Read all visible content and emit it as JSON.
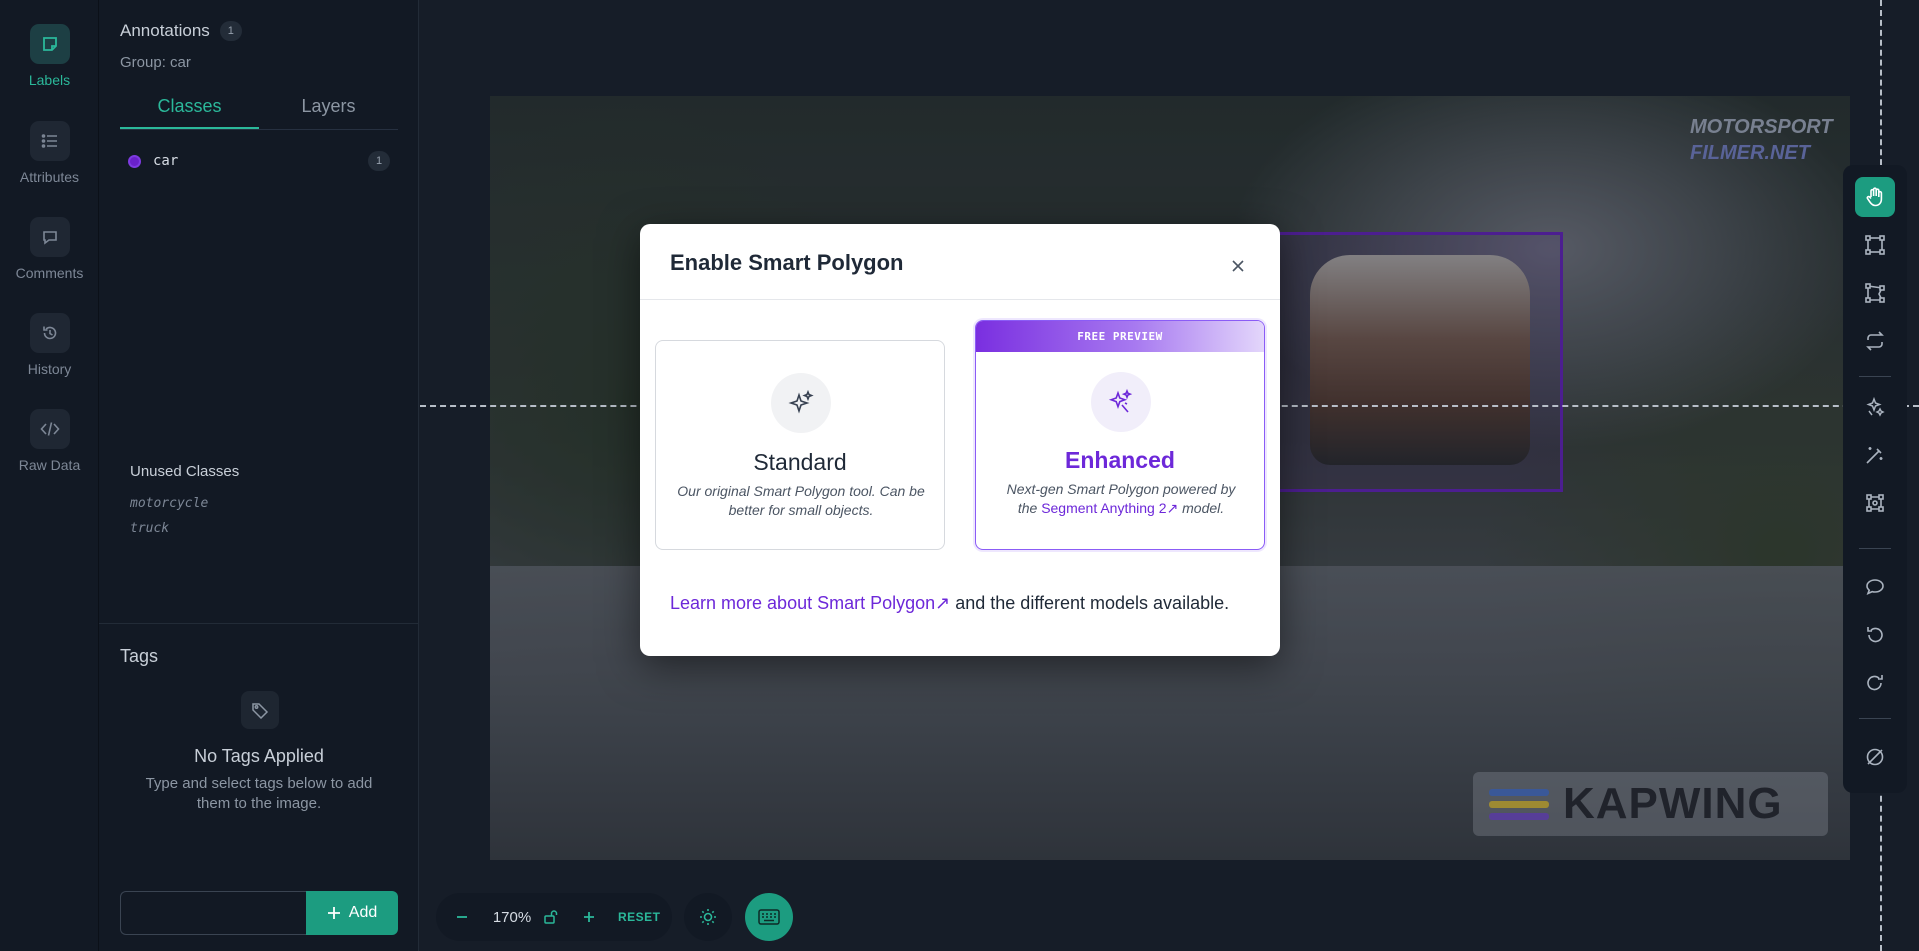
{
  "rail": {
    "items": [
      {
        "label": "Labels",
        "icon": "label-icon",
        "active": true
      },
      {
        "label": "Attributes",
        "icon": "list-icon",
        "active": false
      },
      {
        "label": "Comments",
        "icon": "comment-icon",
        "active": false
      },
      {
        "label": "History",
        "icon": "history-icon",
        "active": false
      },
      {
        "label": "Raw Data",
        "icon": "code-icon",
        "active": false
      }
    ]
  },
  "panel": {
    "title": "Annotations",
    "count": "1",
    "group": "Group: car",
    "tabs": [
      {
        "label": "Classes",
        "active": true
      },
      {
        "label": "Layers",
        "active": false
      }
    ],
    "classes": [
      {
        "name": "car",
        "count": "1",
        "color": "#6a21c9"
      }
    ],
    "unused_title": "Unused Classes",
    "unused": [
      "motorcycle",
      "truck"
    ],
    "tags_title": "Tags",
    "no_tags_title": "No Tags Applied",
    "no_tags_desc": "Type and select tags below to add them to the image.",
    "tag_input_value": "",
    "add_label": "Add"
  },
  "canvas": {
    "watermark_top_1": "MOTORSPORT",
    "watermark_top_2": "FILMER.NET",
    "watermark_bottom": "KAPWING"
  },
  "toolbar": {
    "tools": [
      "hand-icon",
      "bounding-box-icon",
      "polygon-icon",
      "repeat-icon",
      "smart-polygon-icon",
      "magic-wand-icon",
      "keypoint-icon",
      "comment-icon",
      "undo-icon",
      "redo-icon",
      "hide-icon"
    ],
    "active": "hand-icon"
  },
  "zoom": {
    "value": "170%",
    "reset_label": "RESET"
  },
  "modal": {
    "title": "Enable Smart Polygon",
    "standard": {
      "name": "Standard",
      "desc": "Our original Smart Polygon tool. Can be better for small objects."
    },
    "enhanced": {
      "banner": "FREE PREVIEW",
      "name": "Enhanced",
      "desc_before": "Next-gen Smart Polygon powered by the ",
      "link": "Segment Anything 2",
      "desc_after": " model."
    },
    "footer_link": "Learn more about Smart Polygon",
    "footer_text": " and the different models available."
  },
  "colors": {
    "accent": "#2bb89a",
    "accent_dark": "#1c9c80",
    "purple": "#6d28d9",
    "class_car": "#6a21c9"
  }
}
